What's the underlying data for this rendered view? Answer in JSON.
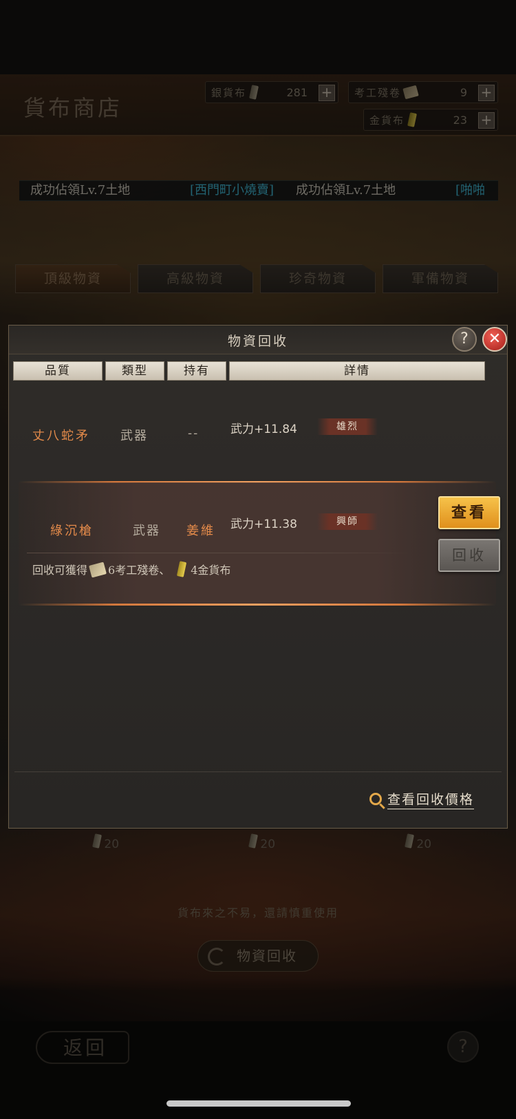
{
  "background": {
    "shop_title": "貨布商店",
    "currencies": [
      {
        "label": "銀貨布",
        "icon": "silver-coin-icon",
        "value": "281"
      },
      {
        "label": "考工殘卷",
        "icon": "scroll-icon",
        "value": "9"
      },
      {
        "label": "金貨布",
        "icon": "gold-coin-icon",
        "value": "23"
      }
    ],
    "news": {
      "part1": "成功佔領Lv.7土地",
      "player": "[西門町小燒賣]",
      "part2": "成功佔領Lv.7土地",
      "player2": "[啪啪"
    },
    "tabs": [
      "頂級物資",
      "高級物資",
      "珍奇物資",
      "軍備物資"
    ],
    "item_prices": [
      "20",
      "20",
      "20"
    ],
    "warning": "貨布來之不易，還請慎重使用",
    "recycle_button": "物資回收",
    "back_button": "返回",
    "help": "?"
  },
  "dialog": {
    "title": "物資回收",
    "help": "?",
    "close": "✕",
    "columns": [
      "品質",
      "類型",
      "持有",
      "詳情"
    ],
    "rows": [
      {
        "name": "丈八蛇矛",
        "type": "武器",
        "owner": "--",
        "stat": "武力+11.84",
        "tag": "雄烈"
      },
      {
        "name": "綠沉槍",
        "type": "武器",
        "owner": "姜維",
        "stat": "武力+11.38",
        "tag": "興師"
      }
    ],
    "reward": {
      "prefix": "回收可獲得",
      "item1": "6考工殘卷、",
      "item2": "4金貨布"
    },
    "view_button": "查看",
    "recycle_button": "回收",
    "price_link": "查看回收價格"
  },
  "colors": {
    "accent_orange": "#e38a4a",
    "link_cyan": "#3fb4d0",
    "view_button": "#f0a830",
    "close_red": "#d83a2e"
  }
}
